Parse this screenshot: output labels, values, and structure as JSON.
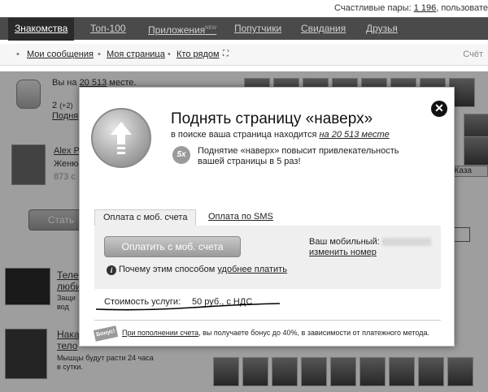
{
  "topbar": {
    "happy_pairs_label": "Счастливые пары:",
    "happy_pairs_count": "1 196",
    "users_label": ", пользовате"
  },
  "nav": {
    "tabs": [
      {
        "label": "Знакомства",
        "active": true
      },
      {
        "label": "Топ-100"
      },
      {
        "label": "Приложения",
        "badge": "NEW"
      },
      {
        "label": "Попутчики"
      },
      {
        "label": "Свидания"
      },
      {
        "label": "Друзья"
      }
    ]
  },
  "subnav": {
    "messages": "Мои сообщения",
    "my_page": "Моя страница",
    "nearby": "Кто рядом",
    "right": "Счёт"
  },
  "background": {
    "rank_line": "Вы на",
    "rank_value": "20 513",
    "rank_suffix": "месте.",
    "rank_two": "2",
    "rank_delta": "(+2)",
    "raise_link": "Подня",
    "profile_name": "Alex P",
    "profile_line2": "Женю",
    "profile_line3": "873 c",
    "become_btn": "Стать",
    "ad1_title": "Теле",
    "ad1_line": "люби",
    "ad1_l2": "Защи",
    "ad1_l3": "вод",
    "ad2_title": "Нака",
    "ad2_line": "тело",
    "ad2_desc1": "Мышцы будут расти 24 часа",
    "ad2_desc2": "в сутки.",
    "right_city": ", Каза"
  },
  "modal": {
    "title": "Поднять страницу «наверх»",
    "search_text": "в поиске ваша страница находится",
    "search_position": "на 20 513 месте",
    "x5_badge": "5x",
    "boost_text": "Поднятие «наверх» повысит привлекательность вашей страницы в 5 раз!",
    "tab_mobile": "Оплата с моб. счета",
    "tab_sms": "Оплата по SMS",
    "pay_button": "Оплатить с моб. счета",
    "mobile_label": "Ваш мобильный: +",
    "change_number": "изменить номер",
    "why_text": "Почему этим способом",
    "why_link": "удобнее платить",
    "cost_label": "Стоимость услуги:",
    "cost_value": "50 руб., с НДС",
    "bonus_badge": "Бонус!",
    "bonus_link": "При пополнении счета",
    "bonus_text": ", вы получаете бонус до 40%, в зависимости от платежного метода."
  }
}
